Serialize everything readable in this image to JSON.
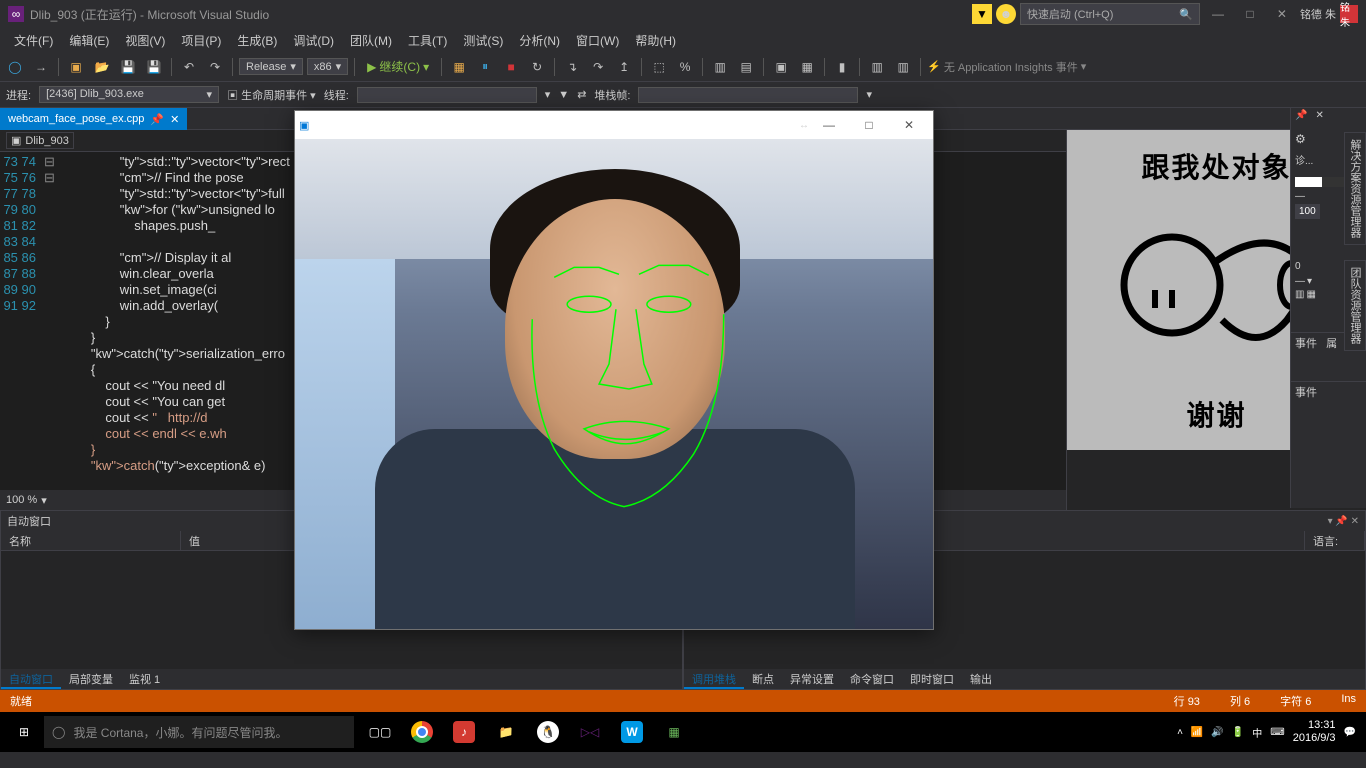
{
  "titlebar": {
    "vs_logo": "▷◁",
    "title": "Dlib_903 (正在运行) - Microsoft Visual Studio",
    "quick_launch_placeholder": "快速启动 (Ctrl+Q)",
    "user_name": "铭德 朱",
    "user_badge": "铭朱"
  },
  "menus": [
    "文件(F)",
    "编辑(E)",
    "视图(V)",
    "项目(P)",
    "生成(B)",
    "调试(D)",
    "团队(M)",
    "工具(T)",
    "测试(S)",
    "分析(N)",
    "窗口(W)",
    "帮助(H)"
  ],
  "toolbar": {
    "config": "Release",
    "platform": "x86",
    "run_label": "继续(C)",
    "insights_label": "无 Application Insights 事件"
  },
  "debugbar": {
    "process_label": "进程:",
    "process_value": "[2436] Dlib_903.exe",
    "lifecycle_label": "生命周期事件",
    "thread_label": "线程:",
    "stackframe_label": "堆栈帧:"
  },
  "tab": {
    "filename": "webcam_face_pose_ex.cpp"
  },
  "nav": {
    "project": "Dlib_903"
  },
  "code": {
    "first_line": 73,
    "lines": [
      "                std::vector<rect",
      "                // Find the pose",
      "                std::vector<full",
      "                for (unsigned lo",
      "                    shapes.push_",
      "",
      "                // Display it al",
      "                win.clear_overla",
      "                win.set_image(ci",
      "                win.add_overlay(",
      "            }",
      "        }",
      "        catch(serialization_erro",
      "        {",
      "            cout << \"You need dl",
      "            cout << \"You can get",
      "            cout << \"   http://d",
      "            cout << endl << e.wh",
      "        }",
      "        catch(exception& e)"
    ]
  },
  "zoom": "100 %",
  "meme": {
    "top": "跟我处对象",
    "bottom": "谢谢"
  },
  "right_props": {
    "value": "100",
    "zero": "0",
    "events_label": "事件",
    "props_label": "属"
  },
  "right_diag": "诊...",
  "bottom": {
    "auto_title": "自动窗口",
    "col_name": "名称",
    "col_value": "值",
    "lang_label": "语言:",
    "left_tabs": [
      "自动窗口",
      "局部变量",
      "监视 1"
    ],
    "right_tabs": [
      "调用堆栈",
      "断点",
      "异常设置",
      "命令窗口",
      "即时窗口",
      "输出"
    ]
  },
  "status": {
    "ready": "就绪",
    "line_label": "行",
    "line": "93",
    "col_label": "列",
    "col": "6",
    "char_label": "字符",
    "char": "6",
    "ins": "Ins"
  },
  "taskbar": {
    "search_text": "我是 Cortana，小娜。有问题尽管问我。",
    "time": "13:31",
    "date": "2016/9/3"
  },
  "vertical_tabs": {
    "solution": "解决方案资源管理器",
    "team": "团队资源管理器"
  }
}
